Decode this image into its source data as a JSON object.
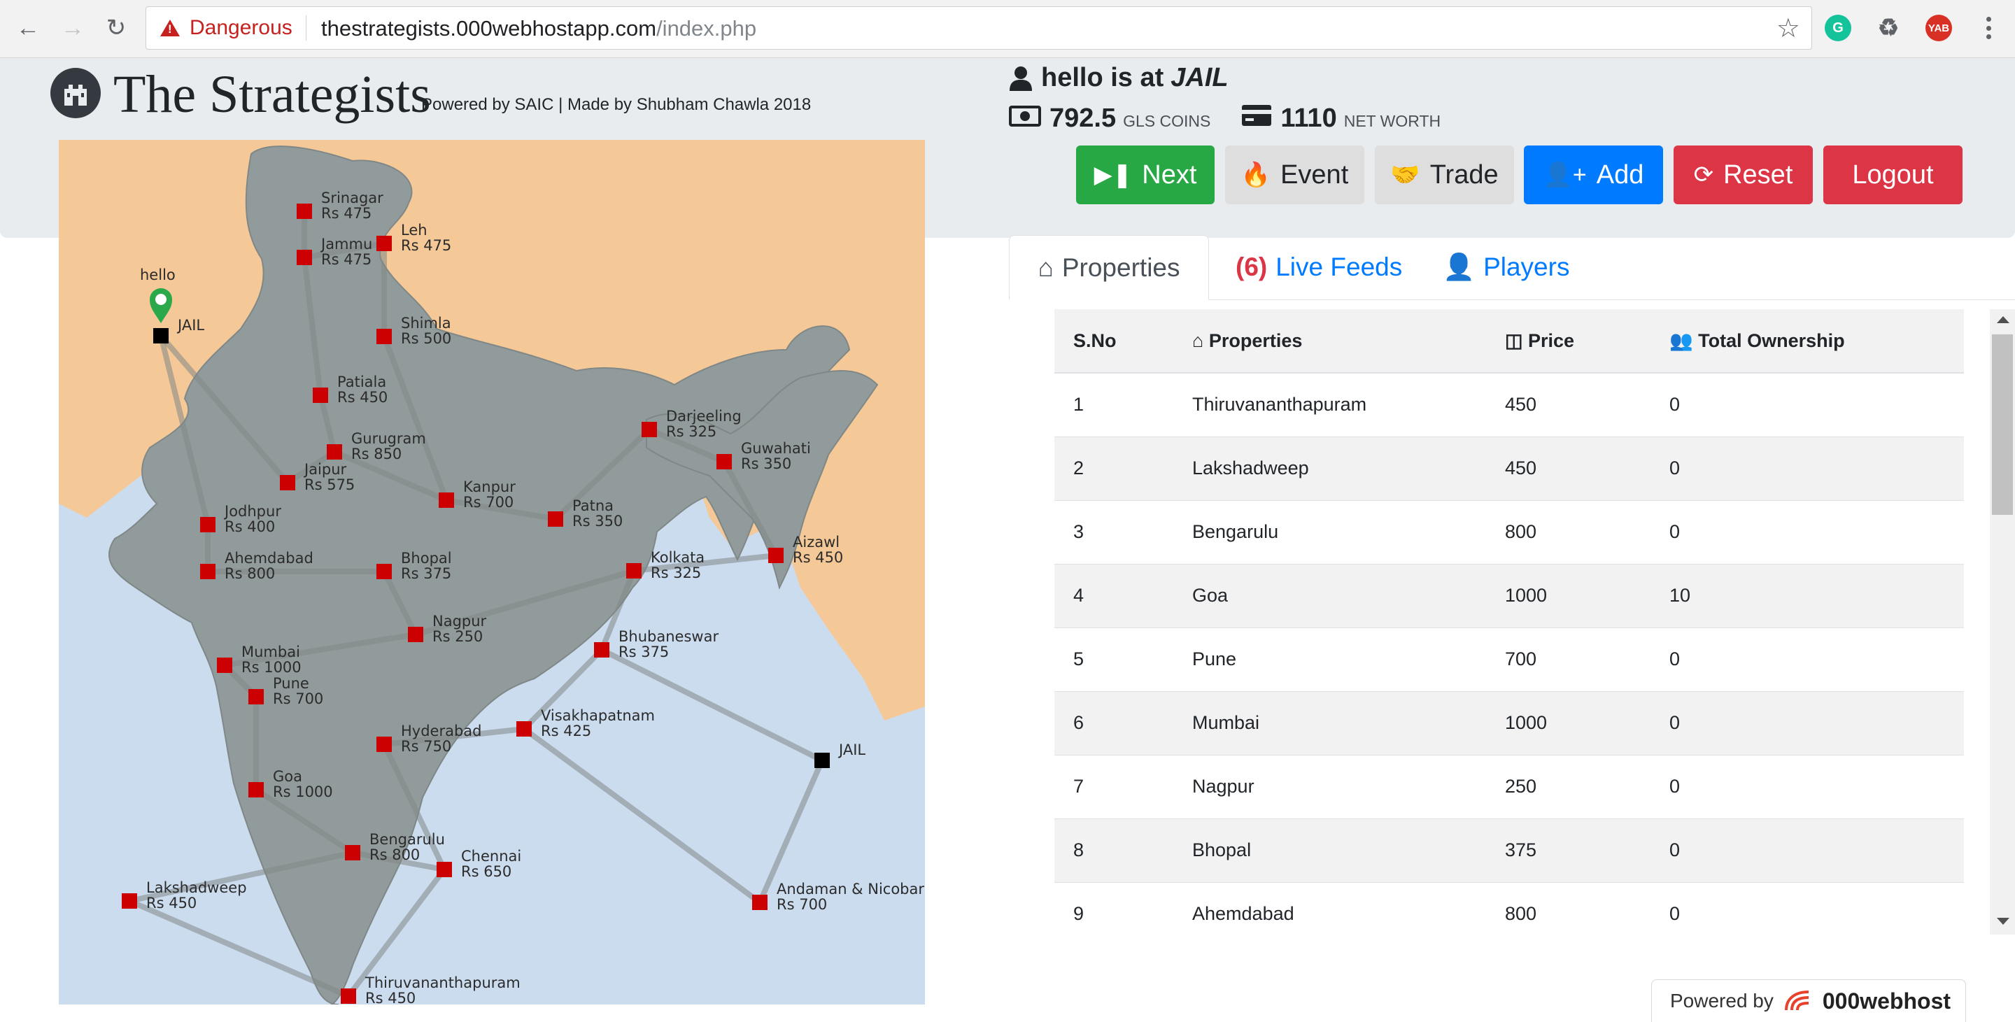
{
  "browser": {
    "security_label": "Dangerous",
    "url_host": "thestrategists.000webhostapp.com",
    "url_path": "/index.php",
    "extensions": [
      {
        "name": "grammarly-icon",
        "label": "G",
        "color": "#15c39a"
      },
      {
        "name": "recycle-icon",
        "label": "♻",
        "color": "#5f6368"
      },
      {
        "name": "profile-avatar",
        "label": "YAB",
        "color": "#d93025"
      }
    ]
  },
  "header": {
    "brand": "The Strategists",
    "subtitle": "Powered by SAIC | Made by Shubham Chawla 2018"
  },
  "status": {
    "prefix": "hello is at",
    "location": "JAIL",
    "coins": "792.5",
    "coins_label": "GLS COINS",
    "net_worth": "1110",
    "net_worth_label": "NET WORTH"
  },
  "actions": [
    {
      "key": "next",
      "label": "Next",
      "color": "#28a745",
      "text_color": "#ffffff"
    },
    {
      "key": "event",
      "label": "Event",
      "color": "#dedede",
      "text_color": "#212529"
    },
    {
      "key": "trade",
      "label": "Trade",
      "color": "#dedede",
      "text_color": "#212529"
    },
    {
      "key": "add",
      "label": "Add",
      "color": "#007bff",
      "text_color": "#ffffff"
    },
    {
      "key": "reset",
      "label": "Reset",
      "color": "#dc3545",
      "text_color": "#ffffff"
    },
    {
      "key": "logout",
      "label": "Logout",
      "color": "#dc3545",
      "text_color": "#ffffff"
    }
  ],
  "map": {
    "player_name": "hello",
    "colors": {
      "land": "#929b9b",
      "neighbor": "#f5c897",
      "sea": "#ccdcef",
      "city": "#cc0000",
      "jail": "#000000",
      "route": "#7f8787"
    },
    "cities": [
      {
        "name": "Srinagar",
        "price": "Rs 475"
      },
      {
        "name": "Jammu",
        "price": "Rs 475"
      },
      {
        "name": "Leh",
        "price": "Rs 475"
      },
      {
        "name": "Shimla",
        "price": "Rs 500"
      },
      {
        "name": "Patiala",
        "price": "Rs 450"
      },
      {
        "name": "Gurugram",
        "price": "Rs 850"
      },
      {
        "name": "Jaipur",
        "price": "Rs 575"
      },
      {
        "name": "Jodhpur",
        "price": "Rs 400"
      },
      {
        "name": "Kanpur",
        "price": "Rs 700"
      },
      {
        "name": "Patna",
        "price": "Rs 350"
      },
      {
        "name": "Darjeeling",
        "price": "Rs 325"
      },
      {
        "name": "Guwahati",
        "price": "Rs 350"
      },
      {
        "name": "Aizawl",
        "price": "Rs 450"
      },
      {
        "name": "Kolkata",
        "price": "Rs 325"
      },
      {
        "name": "Ahemdabad",
        "price": "Rs 800"
      },
      {
        "name": "Bhopal",
        "price": "Rs 375"
      },
      {
        "name": "Nagpur",
        "price": "Rs 250"
      },
      {
        "name": "Bhubaneswar",
        "price": "Rs 375"
      },
      {
        "name": "Mumbai",
        "price": "Rs 1000"
      },
      {
        "name": "Pune",
        "price": "Rs 700"
      },
      {
        "name": "Hyderabad",
        "price": "Rs 750"
      },
      {
        "name": "Visakhapatnam",
        "price": "Rs 425"
      },
      {
        "name": "Goa",
        "price": "Rs 1000"
      },
      {
        "name": "Bengarulu",
        "price": "Rs 800"
      },
      {
        "name": "Chennai",
        "price": "Rs 650"
      },
      {
        "name": "Lakshadweep",
        "price": "Rs 450"
      },
      {
        "name": "Andaman & Nicobar",
        "price": "Rs 700"
      },
      {
        "name": "Thiruvananthapuram",
        "price": "Rs 450"
      }
    ],
    "jails": [
      "JAIL",
      "JAIL"
    ]
  },
  "tabs": [
    {
      "label": "Properties",
      "active": true
    },
    {
      "count": "(6)",
      "label": "Live Feeds",
      "active": false
    },
    {
      "label": "Players",
      "active": false
    }
  ],
  "table": {
    "columns": [
      "S.No",
      "Properties",
      "Price",
      "Total Ownership"
    ],
    "rows": [
      [
        "1",
        "Thiruvananthapuram",
        "450",
        "0"
      ],
      [
        "2",
        "Lakshadweep",
        "450",
        "0"
      ],
      [
        "3",
        "Bengarulu",
        "800",
        "0"
      ],
      [
        "4",
        "Goa",
        "1000",
        "10"
      ],
      [
        "5",
        "Pune",
        "700",
        "0"
      ],
      [
        "6",
        "Mumbai",
        "1000",
        "0"
      ],
      [
        "7",
        "Nagpur",
        "250",
        "0"
      ],
      [
        "8",
        "Bhopal",
        "375",
        "0"
      ],
      [
        "9",
        "Ahemdabad",
        "800",
        "0"
      ]
    ]
  },
  "footer": {
    "powered_label": "Powered by",
    "host_brand": "000webhost"
  }
}
